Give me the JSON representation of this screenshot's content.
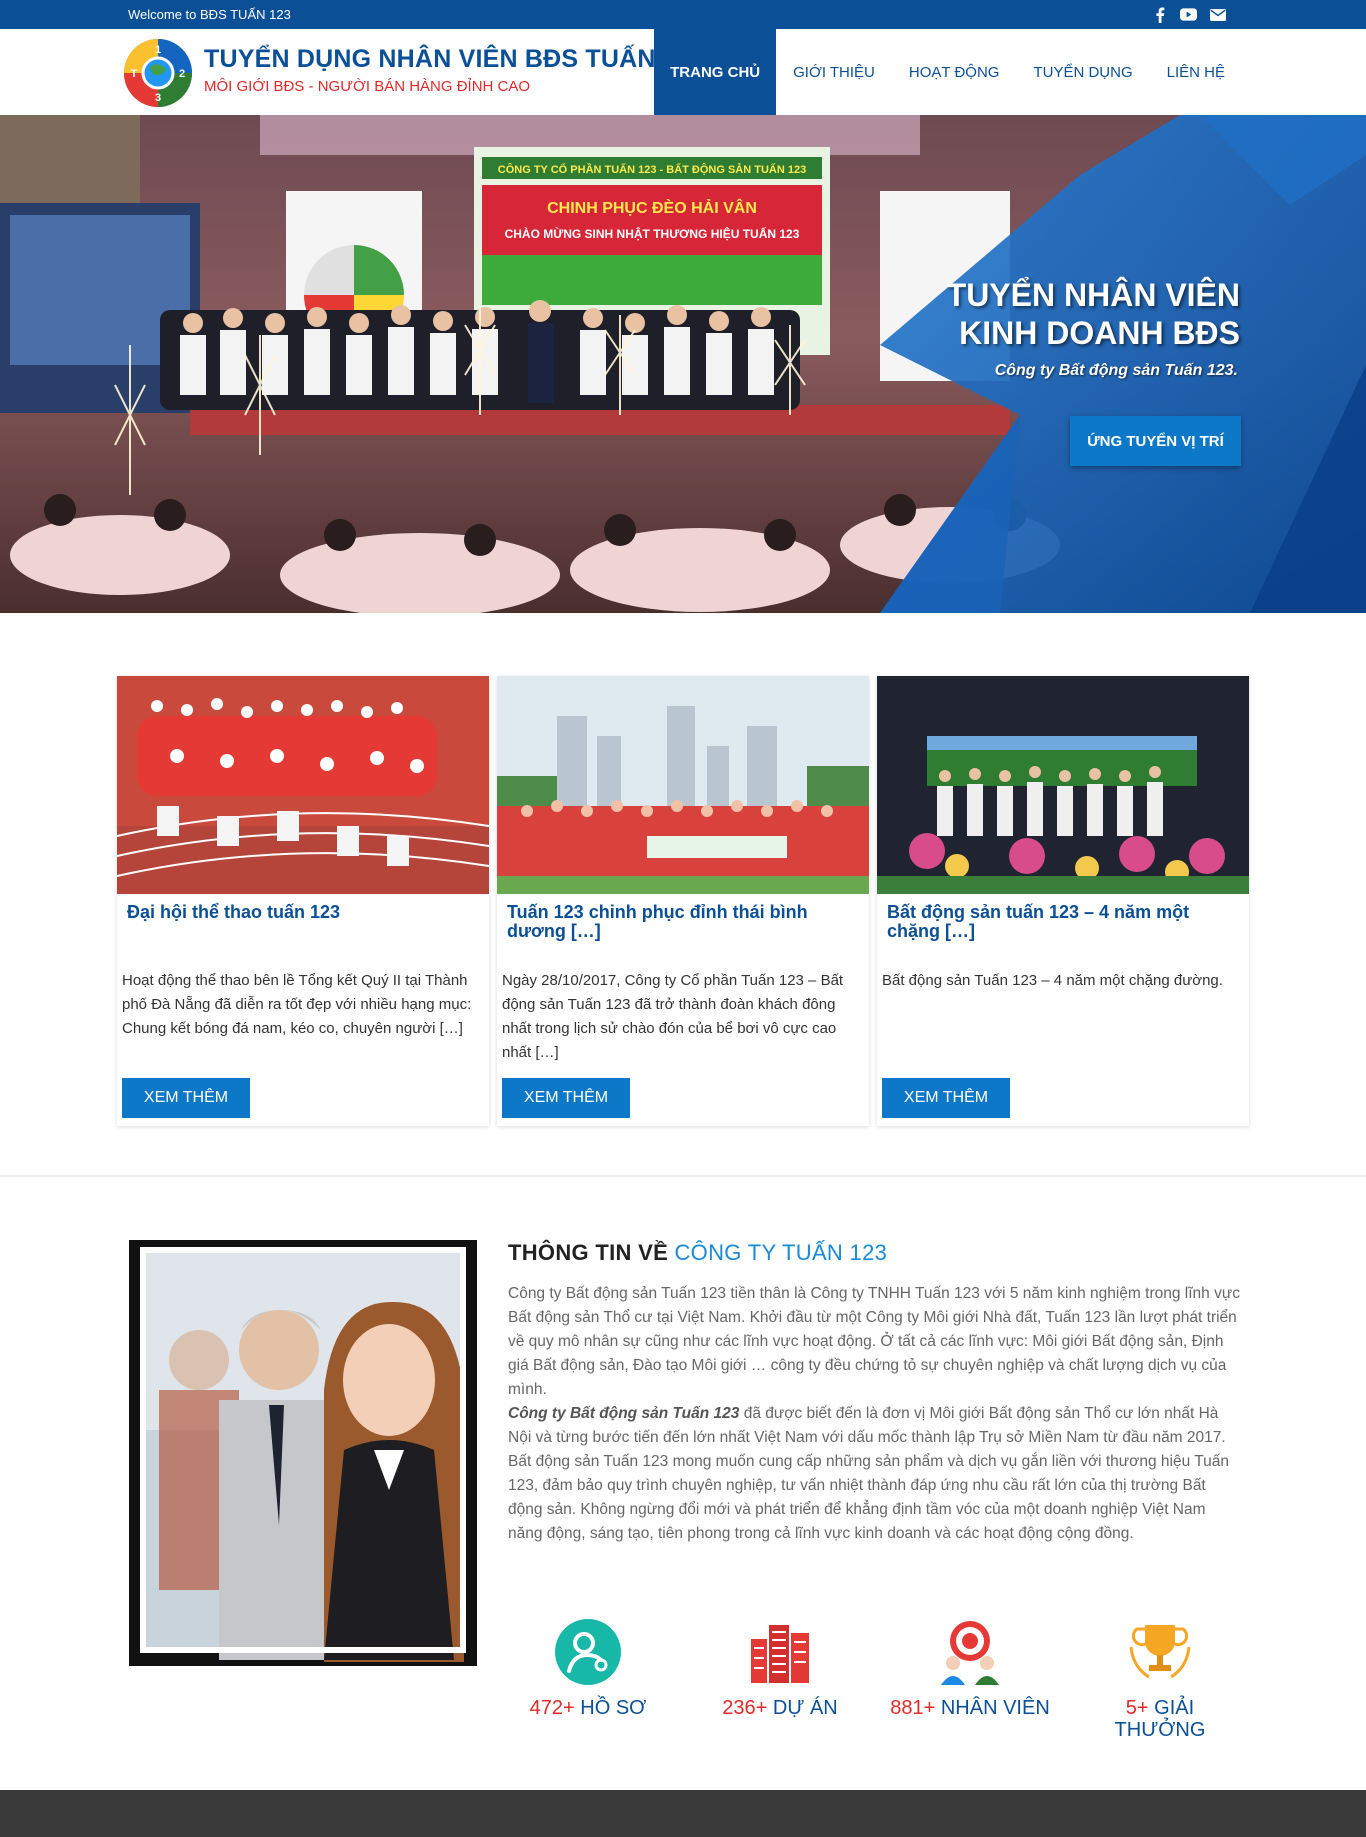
{
  "topbar": {
    "welcome": "Welcome to BĐS TUẤN 123",
    "socials": [
      "facebook-icon",
      "youtube-icon",
      "envelope-icon"
    ]
  },
  "brand": {
    "title": "TUYỂN DỤNG NHÂN VIÊN BĐS TUẤN 123",
    "subtitle": "MÔI GIỚI BĐS - NGƯỜI BÁN HÀNG ĐỈNH CAO"
  },
  "nav": [
    "TRANG CHỦ",
    "GIỚI THIỆU",
    "HOẠT ĐỘNG",
    "TUYỂN DỤNG",
    "LIÊN HỆ"
  ],
  "hero": {
    "title_line1": "TUYỂN NHÂN VIÊN",
    "title_line2": "KINH DOANH BĐS",
    "subtitle": "Công ty Bất động sản Tuấn 123.",
    "button": "ỨNG TUYỂN VỊ TRÍ",
    "banner_line1": "CÔNG TY CỔ PHẦN TUẤN 123 - BẤT ĐỘNG SẢN TUẤN 123",
    "banner_line2": "CHINH PHỤC ĐÈO HẢI VÂN",
    "banner_line3": "CHÀO MỪNG SINH NHẬT THƯƠNG HIỆU TUẤN 123"
  },
  "cards": [
    {
      "title": "Đại hội thể thao tuấn 123",
      "text": "Hoạt động thể thao bên lề Tổng kết Quý II tại Thành phố Đà Nẵng đã diễn ra tốt đẹp với nhiều hạng mục: Chung kết bóng đá nam, kéo co, chuyên người […]",
      "button": "XEM THÊM"
    },
    {
      "title": "Tuấn 123 chinh phục đỉnh thái bình dương […]",
      "text": "Ngày 28/10/2017, Công ty Cổ phần Tuấn 123 – Bất động sản Tuấn 123 đã trở thành đoàn khách đông nhất trong lịch sử chào đón của bể bơi vô cực cao nhất […]",
      "button": "XEM THÊM"
    },
    {
      "title": "Bất động sản tuấn 123 – 4 năm một chặng […]",
      "text": "Bất động sản Tuấn 123 – 4 năm một chặng đường.",
      "button": "XEM THÊM"
    }
  ],
  "about": {
    "heading_prefix": "THÔNG TIN VỀ",
    "heading_highlight": "CÔNG TY TUẤN 123",
    "p1": "Công ty Bất động sản Tuấn 123 tiền thân là Công ty TNHH Tuấn 123 với 5 năm kinh nghiệm trong lĩnh vực Bất động sản Thổ cư tại Việt Nam. Khởi đầu từ một Công ty Môi giới Nhà đất, Tuấn 123 lần lượt phát triển về quy mô nhân sự cũng như các lĩnh vực hoạt động. Ở tất cả các lĩnh vực: Môi giới Bất động sản, Định giá Bất động sản, Đào tạo Môi giới … công ty đều chứng tỏ sự chuyên nghiệp và chất lượng dịch vụ của mình.",
    "p2_em": "Công ty Bất động sản Tuấn 123",
    "p2_rest": " đã được biết đến là đơn vị Môi giới Bất động sản Thổ cư lớn nhất Hà Nội và từng bước tiến đến lớn nhất Việt Nam với dấu mốc thành lập Trụ sở Miền Nam từ đầu năm 2017.",
    "p3": "Bất động sản Tuấn 123 mong muốn cung cấp những sản phẩm và dịch vụ gắn liền với thương hiệu Tuấn 123, đảm bảo quy trình chuyên nghiệp, tư vấn nhiệt thành đáp ứng nhu cầu rất lớn của thị trường Bất động sản. Không ngừng đổi mới và phát triển để khẳng định tầm vóc của một doanh nghiệp Việt Nam năng động, sáng tạo, tiên phong trong cả lĩnh vực kinh doanh và các hoạt động cộng đồng."
  },
  "stats": [
    {
      "num": "472+",
      "label": "HỒ SƠ",
      "icon": "profile-icon"
    },
    {
      "num": "236+",
      "label": "DỰ ÁN",
      "icon": "buildings-icon"
    },
    {
      "num": "881+",
      "label": "NHÂN VIÊN",
      "icon": "target-team-icon"
    },
    {
      "num": "5+",
      "label": "GIẢI THƯỞNG",
      "icon": "trophy-icon"
    }
  ],
  "colors": {
    "primary": "#0b4f96",
    "accent": "#0d78c8",
    "highlight": "#1a8ad8",
    "red": "#e02a2a"
  }
}
